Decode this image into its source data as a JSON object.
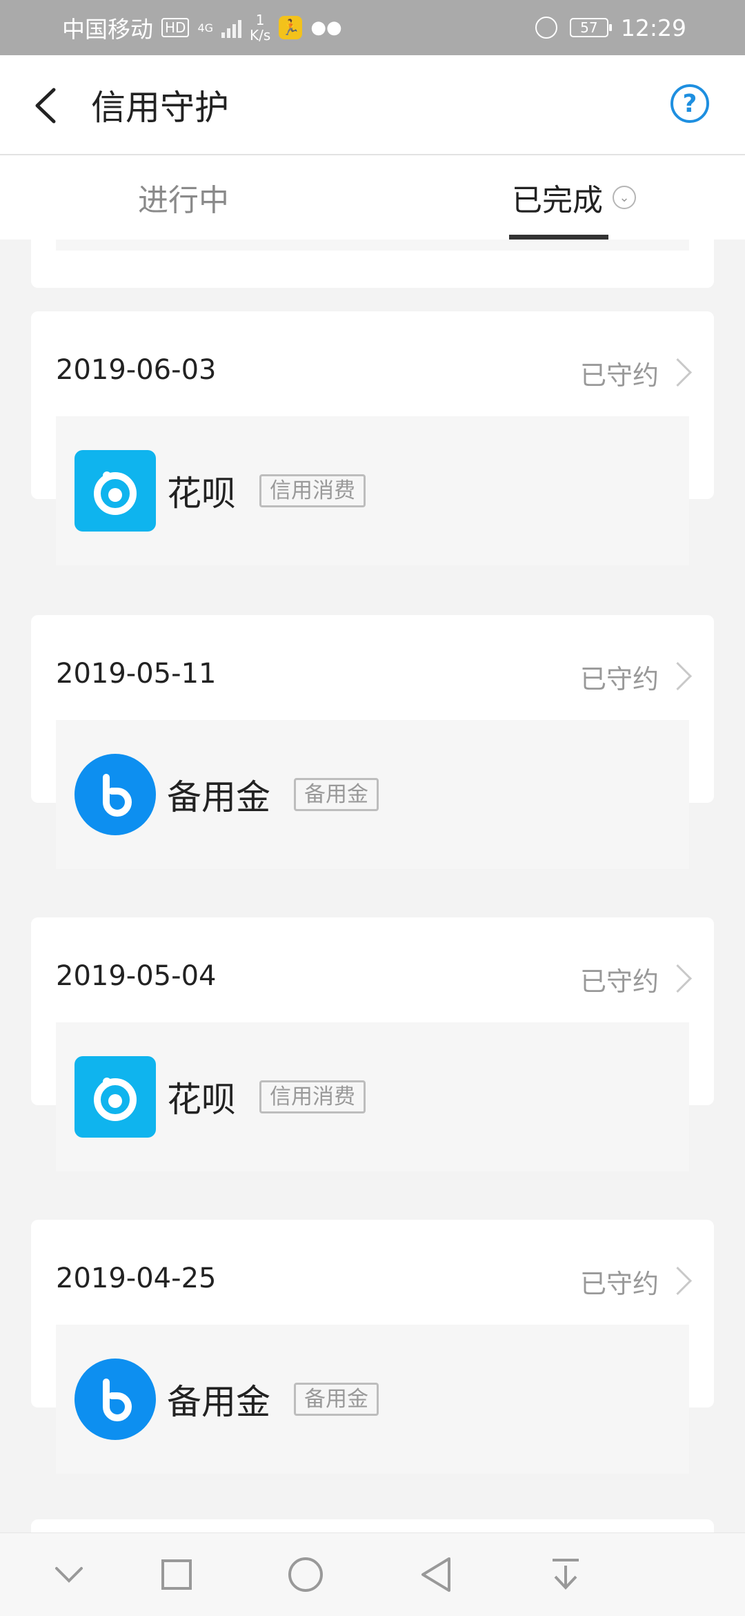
{
  "status_bar": {
    "carrier": "中国移动",
    "hd": "HD",
    "network": "4G",
    "speed_value": "1",
    "speed_unit": "K/s",
    "battery": "57",
    "time": "12:29"
  },
  "header": {
    "title": "信用守护"
  },
  "tabs": [
    {
      "label": "进行中",
      "active": false
    },
    {
      "label": "已完成",
      "active": true
    }
  ],
  "records": [
    {
      "date": "2019-06-03",
      "status": "已守约",
      "product": "花呗",
      "tag": "信用消费",
      "icon": "huabei-logo-icon"
    },
    {
      "date": "2019-05-11",
      "status": "已守约",
      "product": "备用金",
      "tag": "备用金",
      "icon": "beiyongjin-logo-icon"
    },
    {
      "date": "2019-05-04",
      "status": "已守约",
      "product": "花呗",
      "tag": "信用消费",
      "icon": "huabei-logo-icon"
    },
    {
      "date": "2019-04-25",
      "status": "已守约",
      "product": "备用金",
      "tag": "备用金",
      "icon": "beiyongjin-logo-icon"
    }
  ],
  "colors": {
    "accent": "#1e8fe0",
    "huabei": "#0fb4ee",
    "beiyongjin": "#0d8ff0"
  }
}
